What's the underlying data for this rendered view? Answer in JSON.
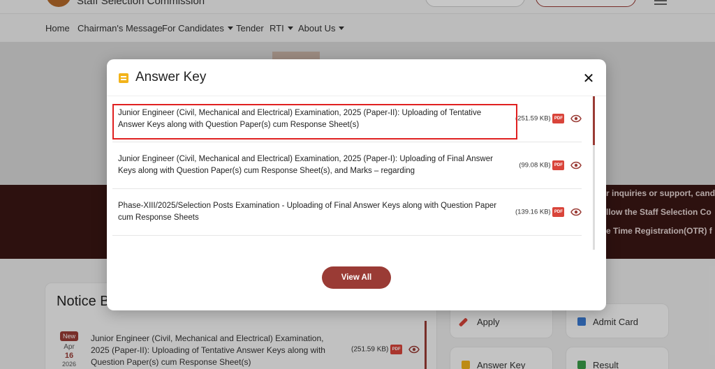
{
  "site": {
    "title": "Staff Selection Commission"
  },
  "nav": {
    "items": [
      {
        "label": "Home"
      },
      {
        "label": "Chairman's Message"
      },
      {
        "label": "For Candidates",
        "has_caret": true
      },
      {
        "label": "Tender"
      },
      {
        "label": "RTI",
        "has_caret": true
      },
      {
        "label": "About Us",
        "has_caret": true
      }
    ]
  },
  "ticker": {
    "lines": [
      "r inquiries or support, cand",
      "llow the Staff Selection Co",
      "e Time Registration(OTR) f"
    ]
  },
  "notice": {
    "title": "Notice B",
    "item": {
      "badge": "New",
      "month": "Apr",
      "day": "16",
      "year": "2026",
      "text": "Junior Engineer (Civil, Mechanical and Electrical) Examination, 2025 (Paper-II): Uploading of Tentative Answer Keys along with Question Paper(s) cum Response Sheet(s)",
      "size": "(251.59 KB)",
      "pdf_label": "PDF"
    }
  },
  "quick_links": [
    {
      "label": "Apply",
      "icon": "pencil-icon",
      "color": "#d9443a"
    },
    {
      "label": "Admit Card",
      "icon": "id-card-icon",
      "color": "#3a7bd5"
    },
    {
      "label": "Answer Key",
      "icon": "list-icon",
      "color": "#f2b31a"
    },
    {
      "label": "Result",
      "icon": "bar-chart-icon",
      "color": "#3a9d4a"
    }
  ],
  "modal": {
    "title": "Answer Key",
    "close_glyph": "✕",
    "view_all_label": "View All",
    "pdf_label": "PDF",
    "items": [
      {
        "text": "Junior Engineer (Civil, Mechanical and Electrical) Examination, 2025 (Paper-II): Uploading of Tentative Answer Keys along with Question Paper(s) cum Response Sheet(s)",
        "size": "(251.59 KB)",
        "highlighted": true
      },
      {
        "text": "Junior Engineer (Civil, Mechanical and Electrical) Examination, 2025 (Paper-I): Uploading of Final Answer Keys along with Question Paper(s) cum Response Sheet(s), and Marks – regarding",
        "size": "(99.08 KB)",
        "highlighted": false
      },
      {
        "text": "Phase-XIII/2025/Selection Posts Examination - Uploading of Final Answer Keys along with Question Paper cum Response Sheets",
        "size": "(139.16 KB)",
        "highlighted": false
      }
    ]
  },
  "colors": {
    "brand": "#9a3b35",
    "pdf": "#d9443a",
    "highlight": "#e02020",
    "header_icon": "#f2b31a"
  }
}
